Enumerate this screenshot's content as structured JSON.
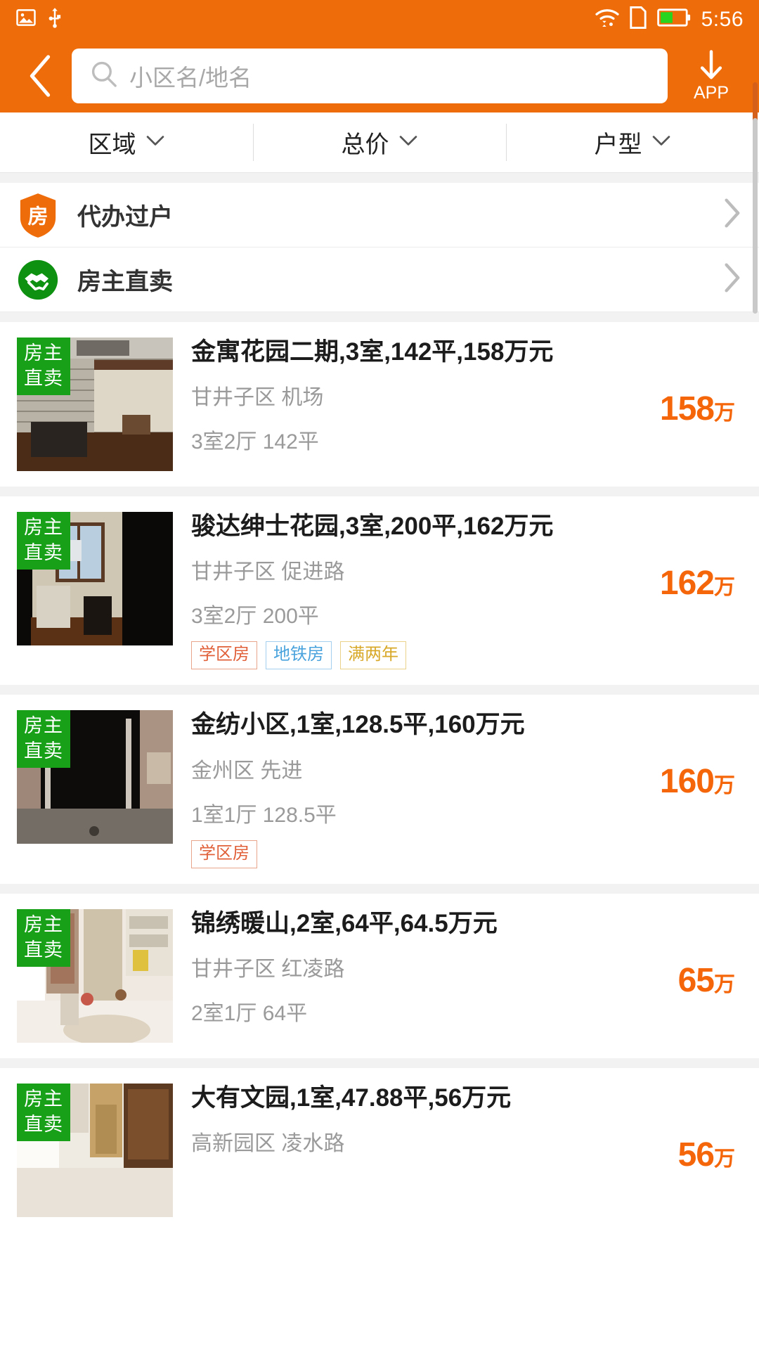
{
  "status_bar": {
    "icons": [
      "image-icon",
      "usb-icon",
      "wifi-icon",
      "sim-card-icon",
      "battery-icon"
    ],
    "time": "5:56",
    "battery_level_pct": 45,
    "bg_color": "#ef6c0a"
  },
  "header": {
    "back_label": "back-chevron",
    "search": {
      "placeholder": "小区名/地名",
      "value": "",
      "icon": "search-icon"
    },
    "app_button": {
      "label": "APP",
      "icon": "download-arrow-icon"
    }
  },
  "filter_bar": {
    "items": [
      {
        "label": "区域",
        "icon": "chevron-down-icon"
      },
      {
        "label": "总价",
        "icon": "chevron-down-icon"
      },
      {
        "label": "户型",
        "icon": "chevron-down-icon"
      }
    ]
  },
  "banners": [
    {
      "label": "代办过户",
      "icon": "shield-house-icon",
      "icon_color": "#ef6c0a",
      "arrow": "chevron-right-icon"
    },
    {
      "label": "房主直卖",
      "icon": "handshake-icon",
      "icon_color": "#0e9010",
      "arrow": "chevron-right-icon"
    }
  ],
  "listings": [
    {
      "badge_line1": "房主",
      "badge_line2": "直卖",
      "title": "金寓花园二期,3室,142平,158万元",
      "location": "甘井子区  机场",
      "layout": "3室2厅  142平",
      "price_num": "158",
      "price_unit": "万",
      "tags": []
    },
    {
      "badge_line1": "房主",
      "badge_line2": "直卖",
      "title": "骏达绅士花园,3室,200平,162万元",
      "location": "甘井子区  促进路",
      "layout": "3室2厅  200平",
      "price_num": "162",
      "price_unit": "万",
      "tags": [
        {
          "label": "学区房",
          "style": "school"
        },
        {
          "label": "地铁房",
          "style": "metro"
        },
        {
          "label": "满两年",
          "style": "twoyr"
        }
      ]
    },
    {
      "badge_line1": "房主",
      "badge_line2": "直卖",
      "title": "金纺小区,1室,128.5平,160万元",
      "location": "金州区  先进",
      "layout": "1室1厅  128.5平",
      "price_num": "160",
      "price_unit": "万",
      "tags": [
        {
          "label": "学区房",
          "style": "school"
        }
      ]
    },
    {
      "badge_line1": "房主",
      "badge_line2": "直卖",
      "title": "锦绣暖山,2室,64平,64.5万元",
      "location": "甘井子区  红凌路",
      "layout": "2室1厅  64平",
      "price_num": "65",
      "price_unit": "万",
      "tags": []
    },
    {
      "badge_line1": "房主",
      "badge_line2": "直卖",
      "title": "大有文园,1室,47.88平,56万元",
      "location": "高新园区  凌水路",
      "layout": "",
      "price_num": "56",
      "price_unit": "万",
      "tags": []
    }
  ],
  "colors": {
    "brand_orange": "#ef6c0a",
    "price_orange": "#f5660a",
    "badge_green": "#17a018",
    "page_bg": "#f2f2f2"
  }
}
